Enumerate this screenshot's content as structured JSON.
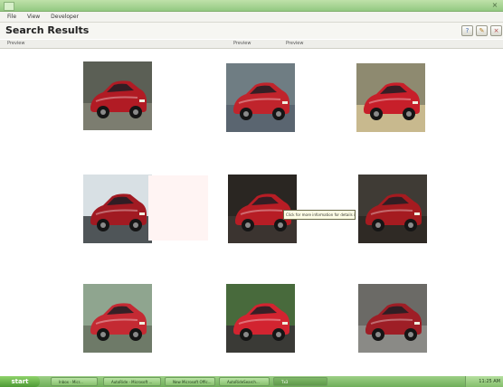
{
  "window": {
    "close_glyph": "×"
  },
  "menu": [
    "File",
    "View",
    "Developer"
  ],
  "header": {
    "title": "Search Results"
  },
  "toolbar": [
    {
      "glyph": "?",
      "icon": "help-icon",
      "color": "#4a6fb0"
    },
    {
      "glyph": "✎",
      "icon": "edit-icon",
      "color": "#b07a20"
    },
    {
      "glyph": "×",
      "icon": "close-icon",
      "color": "#b04040"
    }
  ],
  "columns": [
    "Preview",
    "Preview",
    "Preview"
  ],
  "results": [
    {
      "name": "red-hatchback-front",
      "bg": "#5b5f55",
      "ground": "#7c7d70",
      "car": "#b11b24"
    },
    {
      "name": "red-hatchback-parked",
      "bg": "#6f7d83",
      "ground": "#5a6570",
      "car": "#c0242c"
    },
    {
      "name": "red-hatchback-side",
      "bg": "#8e8a70",
      "ground": "#c8b98e",
      "car": "#c71f2a"
    },
    {
      "name": "red-hatchback-waterfall",
      "bg": "#d8e0e4",
      "ground": "#4f5558",
      "car": "#a11a22"
    },
    {
      "name": "red-hatchback-studio",
      "bg": "#2a2622",
      "ground": "#3b3430",
      "car": "#b71d25"
    },
    {
      "name": "red-suv-front",
      "bg": "#3f3b35",
      "ground": "#2f2a25",
      "car": "#a51b20"
    },
    {
      "name": "red-sedan-side",
      "bg": "#8fa58f",
      "ground": "#6e7a68",
      "car": "#c42a33"
    },
    {
      "name": "red-hatchback-road",
      "bg": "#486a3c",
      "ground": "#3a3a36",
      "car": "#d22430"
    },
    {
      "name": "red-suv-parked",
      "bg": "#6b6a66",
      "ground": "#8a8a86",
      "car": "#9e1e26"
    }
  ],
  "tooltip": "Click for more information for details images",
  "taskbar": {
    "start": "start",
    "tasks": [
      "Inbox - Micr...",
      "AutoRide - Microsoft ...",
      "New Microsoft Offic...",
      "AutoRideSearch...",
      "Tx3"
    ],
    "clock": "11:25 AM"
  }
}
